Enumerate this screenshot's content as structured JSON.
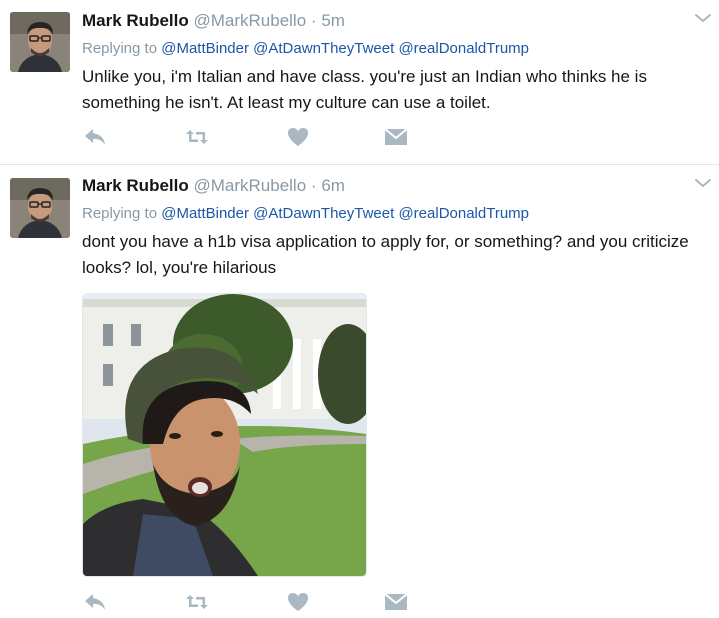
{
  "tweets": [
    {
      "name": "Mark Rubello",
      "handle": "@MarkRubello",
      "separator": "·",
      "time": "5m",
      "replying_prefix": "Replying to",
      "mentions": [
        "@MattBinder",
        "@AtDawnTheyTweet",
        "@realDonaldTrump"
      ],
      "text": "Unlike you, i'm Italian and have class.  you're just an Indian who thinks he is something he isn't.  At least my culture can use a toilet."
    },
    {
      "name": "Mark Rubello",
      "handle": "@MarkRubello",
      "separator": "·",
      "time": "6m",
      "replying_prefix": "Replying to",
      "mentions": [
        "@MattBinder",
        "@AtDawnTheyTweet",
        "@realDonaldTrump"
      ],
      "text": "dont you have a h1b visa application to apply for, or something?  and you criticize looks?  lol, you're hilarious"
    }
  ],
  "icons": {
    "more": "chevron-down-icon",
    "reply": "reply-icon",
    "retweet": "retweet-icon",
    "like": "heart-icon",
    "message": "envelope-icon"
  },
  "colors": {
    "link": "#1b57a8",
    "muted": "#8899a6",
    "text": "#14171a",
    "icon": "#aab8c2",
    "divider": "#e1e8ed"
  }
}
